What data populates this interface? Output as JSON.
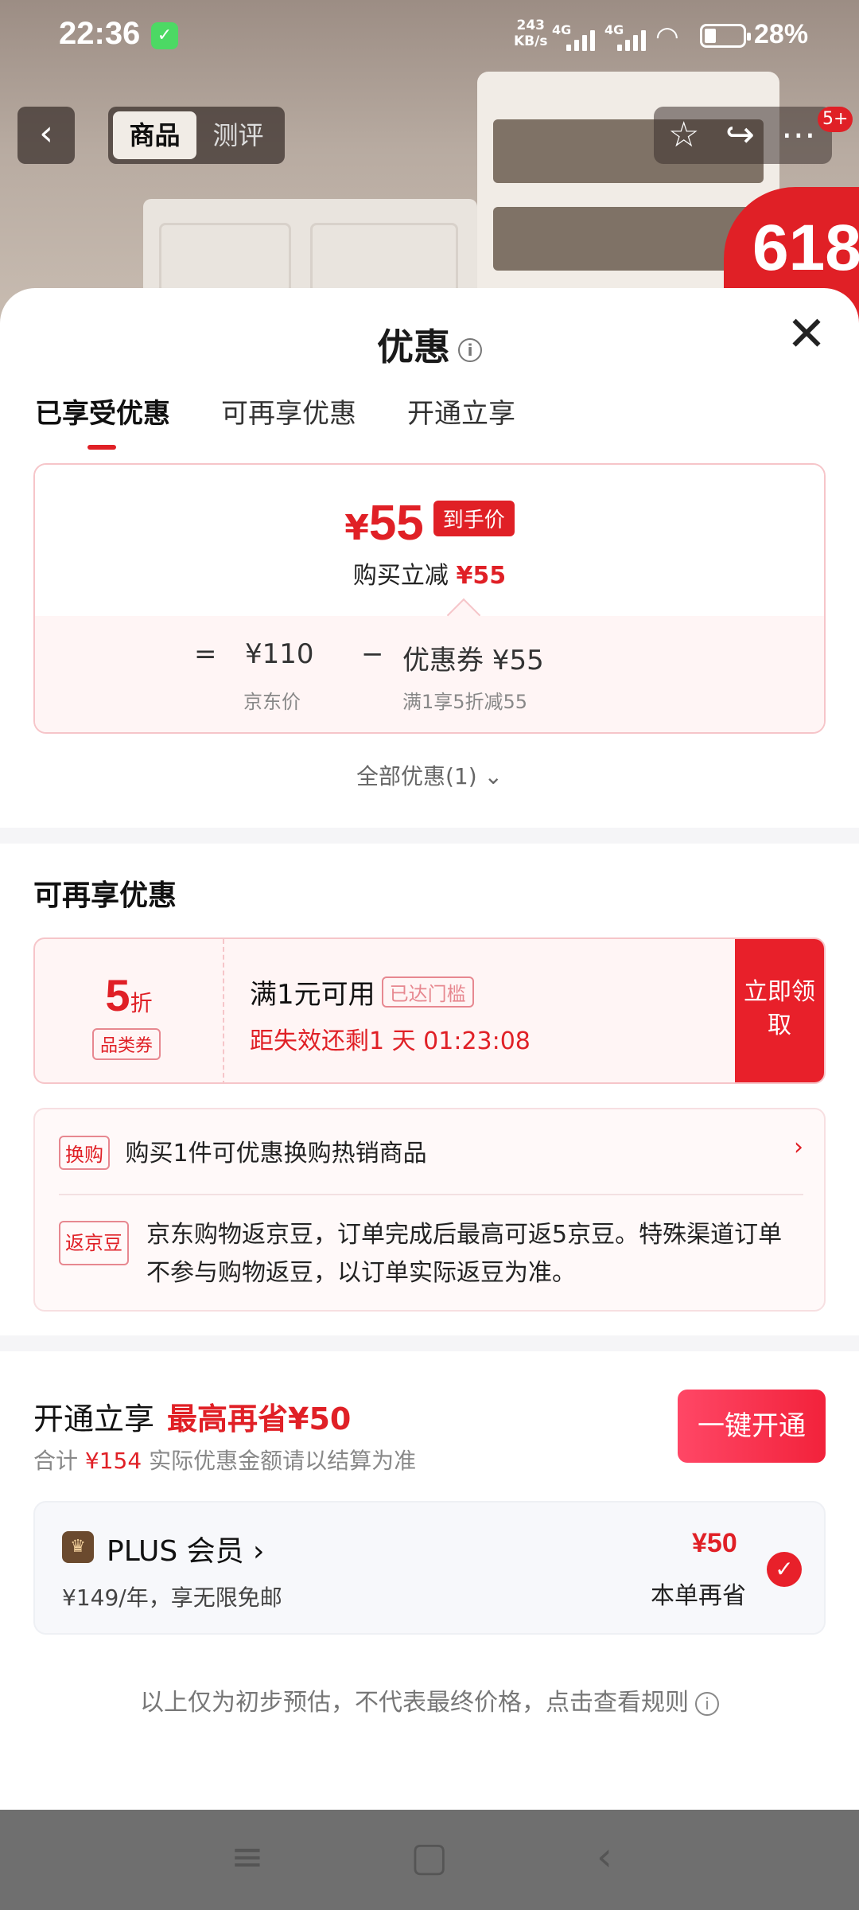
{
  "status_bar": {
    "time": "22:36",
    "net_speed_value": "243",
    "net_speed_unit": "KB/s",
    "signal1": "4G",
    "signal2": "4G",
    "battery": "28%"
  },
  "page_nav": {
    "tabs": [
      "商品",
      "测评"
    ],
    "cart_badge": "5+",
    "promo_badge": "618"
  },
  "sheet": {
    "title": "优惠",
    "tabs": [
      "已享受优惠",
      "可再享优惠",
      "开通立享"
    ],
    "price_card": {
      "yen": "¥",
      "price": "55",
      "price_tag": "到手价",
      "reduce_label": "购买立减",
      "reduce_value": "¥55",
      "eq": "=",
      "jd_price": "¥110",
      "minus": "−",
      "coupon_label": "优惠券 ¥55",
      "jd_price_label": "京东价",
      "coupon_rule": "满1享5折减55"
    },
    "all_offers": "全部优惠(1)",
    "more_section": {
      "title": "可再享优惠",
      "coupon": {
        "discount": "5",
        "discount_unit": "折",
        "category": "品类券",
        "condition": "满1元可用",
        "reached": "已达门槛",
        "expire": "距失效还剩1 天 01:23:08",
        "claim": "立即领取"
      },
      "exchange": {
        "tag": "换购",
        "text": "购买1件可优惠换购热销商品"
      },
      "bean": {
        "tag": "返京豆",
        "text": "京东购物返京豆，订单完成后最高可返5京豆。特殊渠道订单不参与购物返豆，以订单实际返豆为准。"
      }
    },
    "plus_section": {
      "title": "开通立享",
      "max_save": "最高再省¥50",
      "total_label": "合计",
      "total_value": "¥154",
      "total_note": "实际优惠金额请以结算为准",
      "open_button": "一键开通",
      "plus_name": "PLUS 会员 ›",
      "plus_price": "¥149/年，享无限免邮",
      "plus_save": "¥50",
      "plus_save_label": "本单再省"
    },
    "disclaimer": "以上仅为初步预估，不代表最终价格，点击查看规则"
  }
}
